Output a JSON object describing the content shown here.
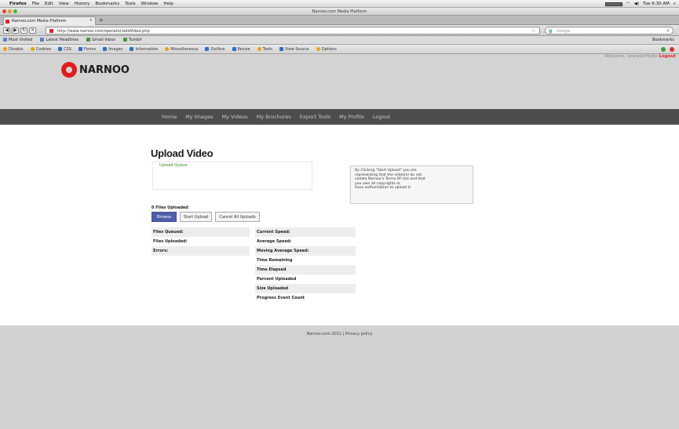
{
  "menubar": {
    "items": [
      "Firefox",
      "File",
      "Edit",
      "View",
      "History",
      "Bookmarks",
      "Tools",
      "Window",
      "Help"
    ],
    "clock": "Tue 6:30 AM"
  },
  "window": {
    "title": "Narnoo.com Media Platform"
  },
  "tab": {
    "label": "Narnoo.com Media Platform"
  },
  "navbar": {
    "url": "http://www.narnoo.com/operator/addVideo.php",
    "search_placeholder": "Google"
  },
  "bookmarks": {
    "items": [
      "Most Visited",
      "Latest Headlines",
      "Gmail Inbox",
      "Tumblr"
    ],
    "right_label": "Bookmarks"
  },
  "toolbar2": {
    "items": [
      "Disable",
      "Cookies",
      "CSS",
      "Forms",
      "Images",
      "Information",
      "Miscellaneous",
      "Outline",
      "Resize",
      "Tools",
      "View Source",
      "Options"
    ]
  },
  "site": {
    "logo_text": "NARNOO",
    "welcome_text": "Welcome, operatorPlatts",
    "logout_label": "Logout",
    "nav": [
      "Home",
      "My Images",
      "My Videos",
      "My Brochures",
      "Export Tools",
      "My Profile",
      "Logout"
    ]
  },
  "upload": {
    "title": "Upload Video",
    "queue_label": "Upload Queue",
    "files_uploaded": "0 Files Uploaded",
    "buttons": {
      "browse": "Browse",
      "start": "Start Upload",
      "cancel": "Cancel All Uploads"
    },
    "notice_lines": [
      "By Clicking \"Start Upload\" you are",
      "representing that the video(s) do not",
      "violate Narnoo's Terms Of Use and that",
      "you own all copyrights or",
      "have authorization to upload it."
    ],
    "stats_left": [
      "Files Queued:",
      "Files Uploaded:",
      "Errors:"
    ],
    "stats_right": [
      "Current Speed:",
      "Average Speed:",
      "Moving Average Speed:",
      "Time Remaining",
      "Time Elapsed",
      "Percent Uploaded",
      "Size Uploaded",
      "Progress Event Count"
    ]
  },
  "footer": {
    "text": "Narnoo.com 2011 | Privacy policy"
  }
}
